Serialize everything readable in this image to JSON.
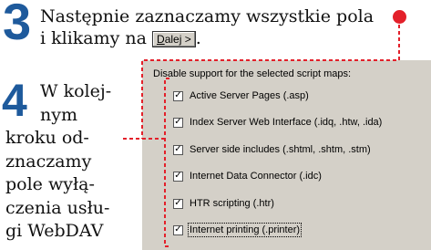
{
  "step3": {
    "number": "3",
    "text_before": "Następnie zaznaczamy wszystkie pola",
    "text_line2": "i klikamy na",
    "button_label_underlined": "D",
    "button_label_rest": "alej >",
    "text_after": "."
  },
  "step4": {
    "number": "4",
    "lines": [
      "W kolej-",
      "nym",
      "kroku od-",
      "znaczamy",
      "pole wyłą-",
      "czenia usłu-",
      "gi WebDAV"
    ]
  },
  "dialog": {
    "title": "Disable support for the selected script maps:",
    "options": [
      {
        "label": "Active Server Pages (.asp)",
        "checked": true
      },
      {
        "label": "Index Server Web Interface (.idq, .htw, .ida)",
        "checked": true
      },
      {
        "label": "Server side includes (.shtml, .shtm, .stm)",
        "checked": true
      },
      {
        "label": "Internet Data Connector (.idc)",
        "checked": true
      },
      {
        "label": "HTR scripting (.htr)",
        "checked": true
      },
      {
        "label": "Internet printing (.printer)",
        "checked": true
      }
    ],
    "check_glyph": "✓"
  },
  "colors": {
    "accent_blue": "#1e5a9c",
    "annotation_red": "#e3202a",
    "dialog_bg": "#d4d0c8"
  }
}
